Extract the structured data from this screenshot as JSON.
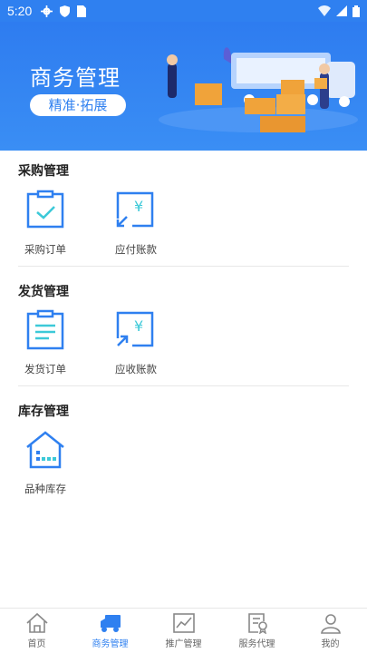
{
  "status": {
    "time": "5:20"
  },
  "banner": {
    "title": "商务管理",
    "tag": "精准·拓展"
  },
  "sections": [
    {
      "title": "采购管理",
      "items": [
        {
          "label": "采购订单",
          "icon": "clipboard-check-icon"
        },
        {
          "label": "应付账款",
          "icon": "yuan-arrow-in-icon"
        }
      ]
    },
    {
      "title": "发货管理",
      "items": [
        {
          "label": "发货订单",
          "icon": "clipboard-list-icon"
        },
        {
          "label": "应收账款",
          "icon": "yuan-arrow-out-icon"
        }
      ]
    },
    {
      "title": "库存管理",
      "items": [
        {
          "label": "品种库存",
          "icon": "warehouse-icon"
        }
      ]
    }
  ],
  "tabs": [
    {
      "label": "首页",
      "icon": "home-icon",
      "active": false
    },
    {
      "label": "商务管理",
      "icon": "truck-icon",
      "active": true
    },
    {
      "label": "推广管理",
      "icon": "trend-chart-icon",
      "active": false
    },
    {
      "label": "服务代理",
      "icon": "certificate-icon",
      "active": false
    },
    {
      "label": "我的",
      "icon": "user-icon",
      "active": false
    }
  ],
  "colors": {
    "primary": "#2f80f0",
    "icon_teal": "#3cc9d8",
    "text": "#222222"
  }
}
